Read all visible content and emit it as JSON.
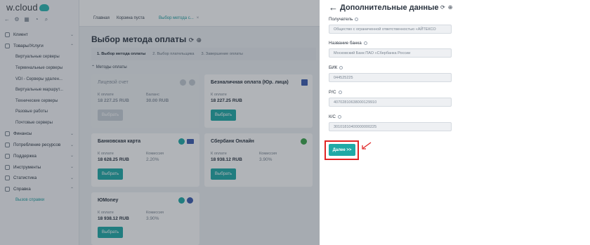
{
  "app": {
    "logo_text": "w.cloud",
    "tabs": [
      {
        "label": "Главная"
      },
      {
        "label": "Корзина пуста"
      },
      {
        "label": "Выбор метода с...",
        "close": "×"
      }
    ],
    "sidebar": {
      "items": [
        {
          "label": "Клиент",
          "chevron": "⌄"
        },
        {
          "label": "Товары/Услуги",
          "chevron": "⌃"
        },
        {
          "label": "Виртуальные серверы"
        },
        {
          "label": "Терминальные серверы"
        },
        {
          "label": "VDI - Серверы удален..."
        },
        {
          "label": "Виртуальные маршрут..."
        },
        {
          "label": "Технические серверы"
        },
        {
          "label": "Разовые работы"
        },
        {
          "label": "Почтовые серверы"
        },
        {
          "label": "Финансы",
          "chevron": "⌄"
        },
        {
          "label": "Потребление ресурсов",
          "chevron": "⌄"
        },
        {
          "label": "Поддержка",
          "chevron": "⌄"
        },
        {
          "label": "Инструменты",
          "chevron": "⌄"
        },
        {
          "label": "Статистика",
          "chevron": "⌄"
        },
        {
          "label": "Справка",
          "chevron": "⌃"
        },
        {
          "label": "Вызов справки"
        }
      ]
    },
    "page_title": "Выбор метода оплаты",
    "steps": [
      "1. Выбор метода оплаты",
      "2. Выбор плательщика",
      "3. Завершение оплаты"
    ],
    "methods_header": "Методы оплаты",
    "payment_methods": [
      {
        "name": "Лицевой счет",
        "label1": "К оплате",
        "amount": "18 227.25 RUB",
        "label2": "Баланс",
        "extra": "30.00 RUB",
        "button": "Выбрать",
        "disabled": true
      },
      {
        "name": "Безналичная оплата (Юр. лица)",
        "label1": "К оплате",
        "amount": "18 227.25 RUB",
        "button": "Выбрать"
      },
      {
        "name": "Банковская карта",
        "label1": "К оплате",
        "amount": "18 628.25 RUB",
        "label2": "Комиссия",
        "extra": "2.20%",
        "button": "Выбрать"
      },
      {
        "name": "Сбербанк Онлайн",
        "label1": "К оплате",
        "amount": "18 938.12 RUB",
        "label2": "Комиссия",
        "extra": "3.90%",
        "button": "Выбрать"
      },
      {
        "name": "ЮMoney",
        "label1": "К оплате",
        "amount": "18 938.12 RUB",
        "label2": "Комиссия",
        "extra": "3.90%",
        "button": "Выбрать"
      }
    ]
  },
  "modal": {
    "back_icon": "←",
    "title": "Дополнительные данные",
    "fields": [
      {
        "label": "Получатель",
        "value": "Общество с ограниченной ответственностью «АЙТЕКСО"
      },
      {
        "label": "Название банка",
        "value": "Московский Банк ПАО «Сбербанка России"
      },
      {
        "label": "БИК",
        "value": "044525225"
      },
      {
        "label": "Р/С",
        "value": "40702810638000129910"
      },
      {
        "label": "К/С",
        "value": "30101810400000000225"
      }
    ],
    "next_button": "Далее >>"
  },
  "colors": {
    "accent": "#1fa9a6",
    "highlight": "#e02424"
  }
}
